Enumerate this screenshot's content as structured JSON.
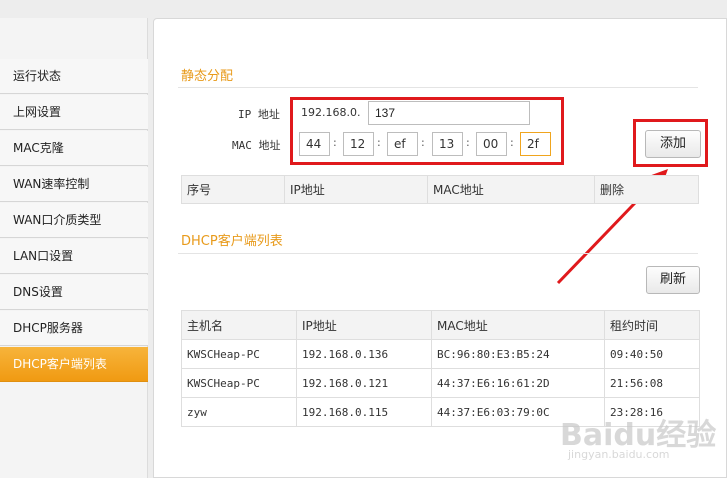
{
  "sidebar": {
    "items": [
      {
        "label": "运行状态",
        "active": false
      },
      {
        "label": "上网设置",
        "active": false
      },
      {
        "label": "MAC克隆",
        "active": false
      },
      {
        "label": "WAN速率控制",
        "active": false
      },
      {
        "label": "WAN口介质类型",
        "active": false
      },
      {
        "label": "LAN口设置",
        "active": false
      },
      {
        "label": "DNS设置",
        "active": false
      },
      {
        "label": "DHCP服务器",
        "active": false
      },
      {
        "label": "DHCP客户端列表",
        "active": true
      }
    ]
  },
  "static": {
    "title": "静态分配",
    "ip_label": "IP 地址",
    "ip_prefix": "192.168.0.",
    "ip_value": "137",
    "mac_label": "MAC 地址",
    "mac_values": [
      "44",
      "12",
      "ef",
      "13",
      "00",
      "2f"
    ],
    "add_button": "添加",
    "table_headers": [
      "序号",
      "IP地址",
      "MAC地址",
      "删除"
    ]
  },
  "clients": {
    "title": "DHCP客户端列表",
    "refresh_button": "刷新",
    "headers": [
      "主机名",
      "IP地址",
      "MAC地址",
      "租约时间"
    ],
    "rows": [
      {
        "host": "KWSCHeap-PC",
        "ip": "192.168.0.136",
        "mac": "BC:96:80:E3:B5:24",
        "lease": "09:40:50"
      },
      {
        "host": "KWSCHeap-PC",
        "ip": "192.168.0.121",
        "mac": "44:37:E6:16:61:2D",
        "lease": "21:56:08"
      },
      {
        "host": "zyw",
        "ip": "192.168.0.115",
        "mac": "44:37:E6:03:79:0C",
        "lease": "23:28:16"
      }
    ]
  },
  "watermark": {
    "brand": "Baidu经验",
    "url": "jingyan.baidu.com"
  },
  "colors": {
    "accent": "#f09a12",
    "annotation": "#e0191c",
    "title": "#e89a1a"
  }
}
